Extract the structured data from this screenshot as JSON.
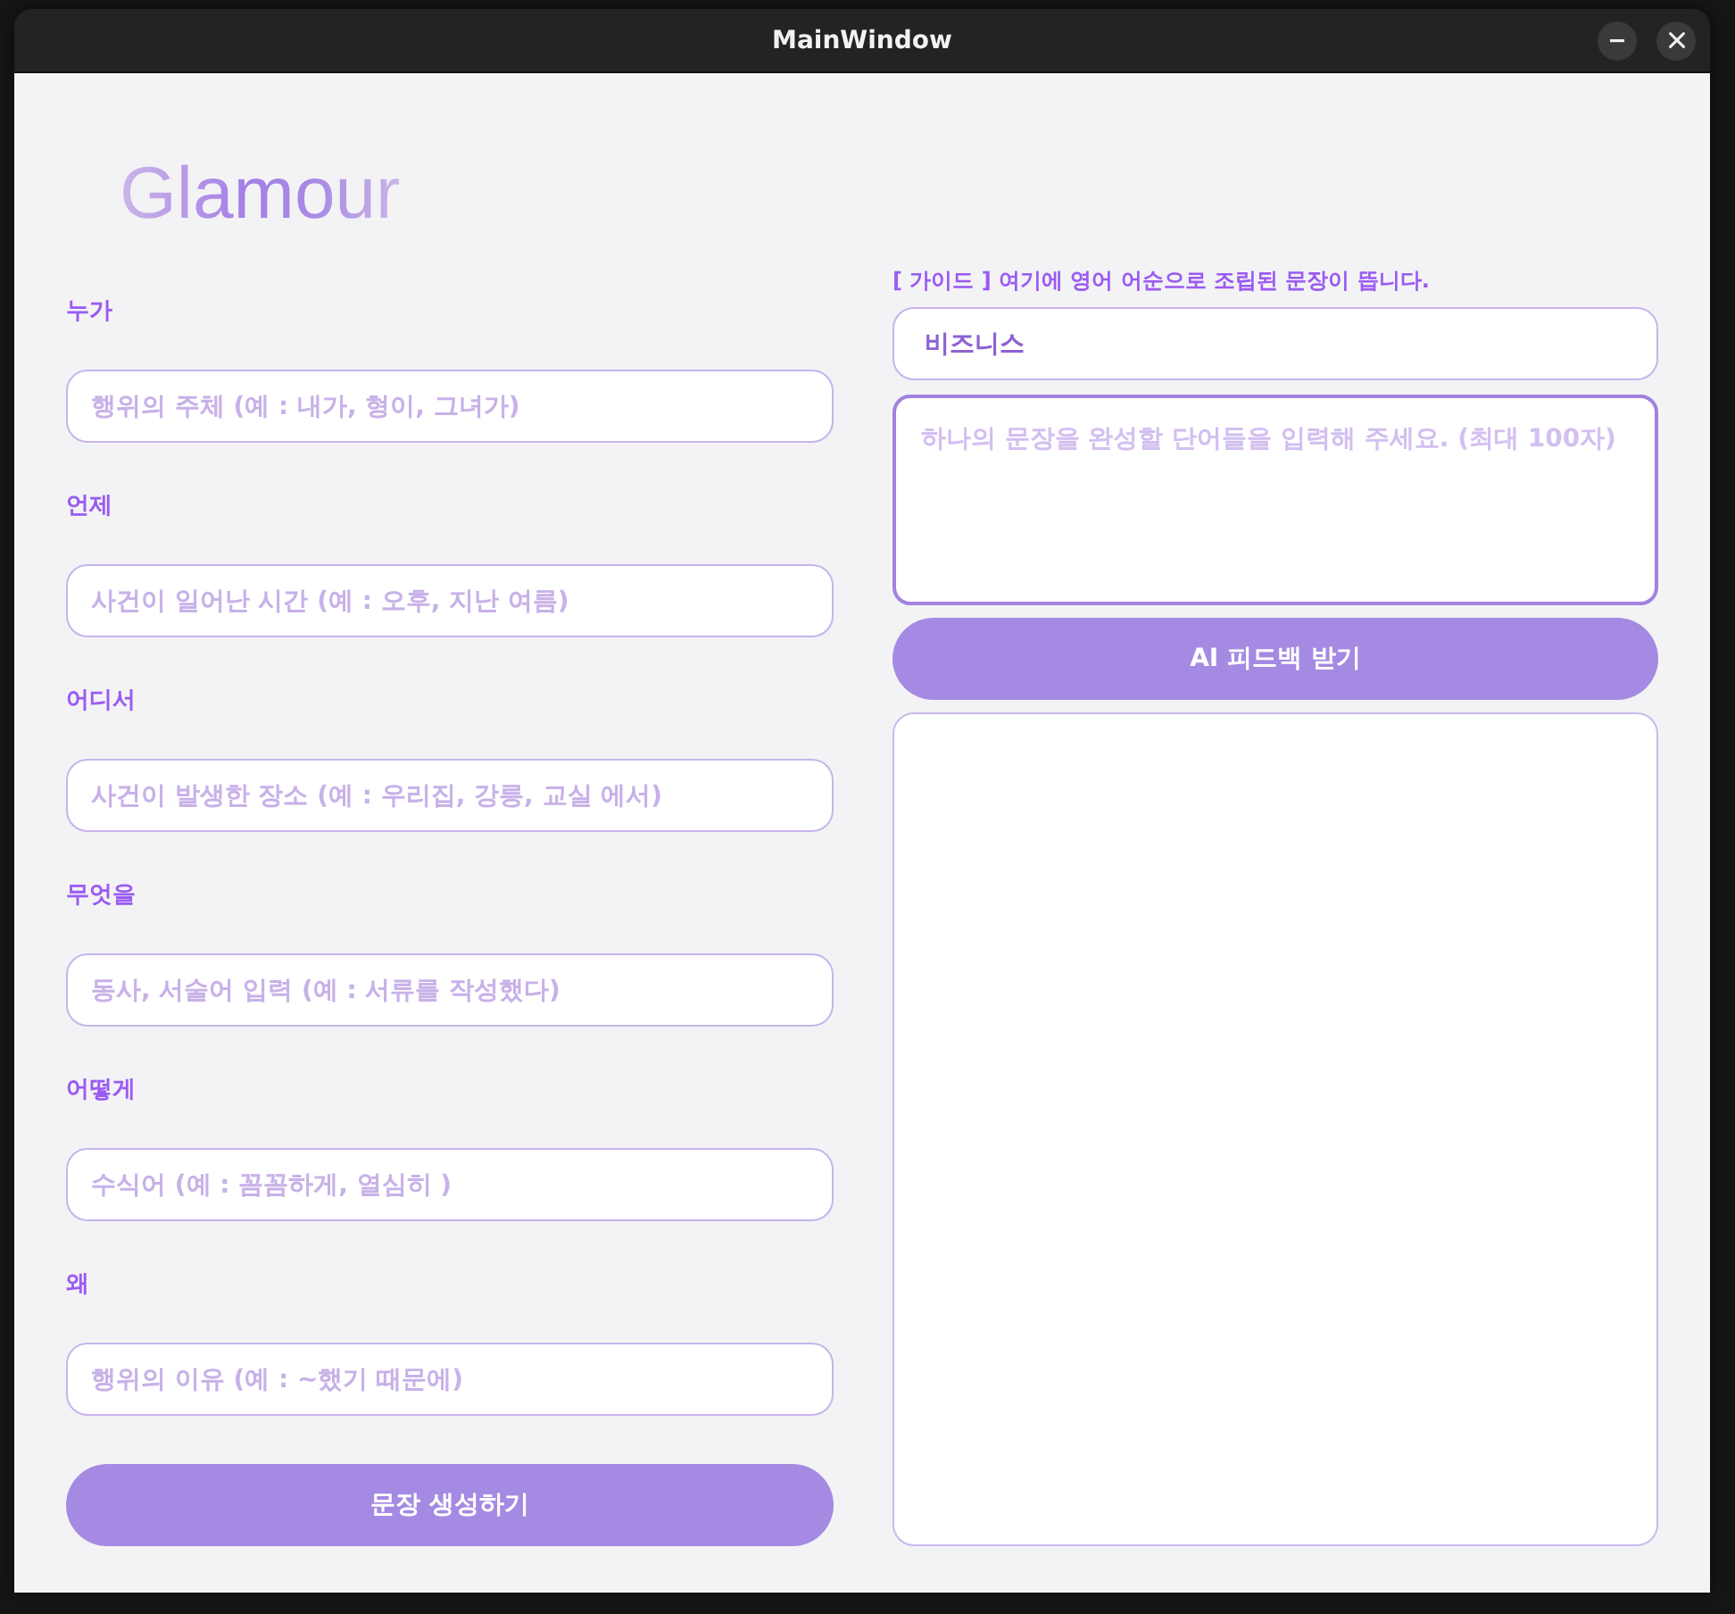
{
  "window": {
    "title": "MainWindow"
  },
  "app_title": "Glamour",
  "form": {
    "fields": [
      {
        "label": "누가",
        "placeholder": "행위의 주체 (예 : 내가, 형이, 그녀가)"
      },
      {
        "label": "언제",
        "placeholder": "사건이 일어난 시간 (예 : 오후, 지난 여름)"
      },
      {
        "label": "어디서",
        "placeholder": "사건이 발생한 장소 (예 : 우리집, 강릉, 교실 에서)"
      },
      {
        "label": "무엇을",
        "placeholder": "동사, 서술어 입력 (예 : 서류를 작성했다)"
      },
      {
        "label": "어떻게",
        "placeholder": "수식어 (예 : 꼼꼼하게, 열심히 )"
      },
      {
        "label": "왜",
        "placeholder": "행위의 이유 (예 : ~했기 때문에)"
      }
    ],
    "submit_button": "문장 생성하기"
  },
  "guide": "[ 가이드 ] 여기에 영어 어순으로 조립된 문장이 뜹니다.",
  "category_field": {
    "value": "비즈니스"
  },
  "words_field": {
    "placeholder": "하나의 문장을 완성할 단어들을 입력해 주세요. (최대 100자)",
    "focused": true
  },
  "feedback_button": "AI 피드백 받기"
}
